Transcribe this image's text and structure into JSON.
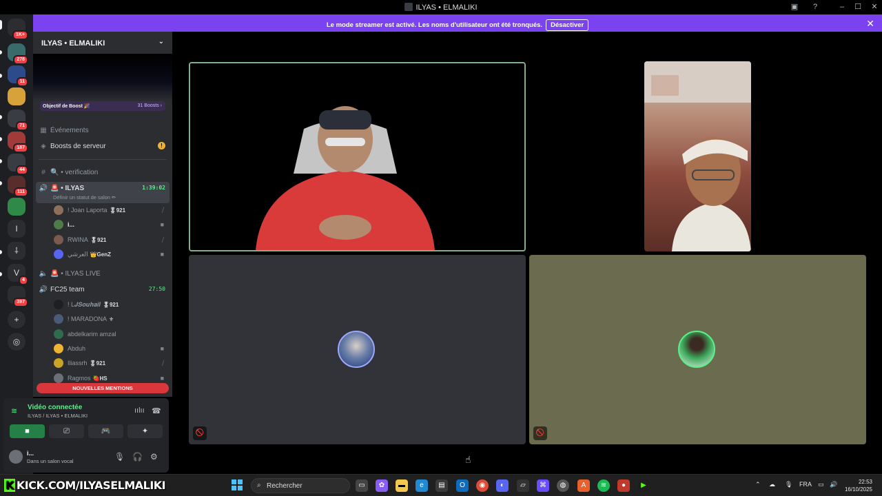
{
  "window": {
    "title": "ILYAS • ELMALIKI"
  },
  "banner": {
    "message": "Le mode streamer est activé. Les noms d'utilisateur ont été tronqués.",
    "button": "Désactiver"
  },
  "rail": {
    "items": [
      {
        "icon": "discord-home-icon",
        "badge": "1K+"
      },
      {
        "icon": "server-icon",
        "badge": "278"
      },
      {
        "icon": "server-icon",
        "badge": "11"
      },
      {
        "icon": "server-icon",
        "badge": ""
      },
      {
        "icon": "server-icon",
        "badge": "71"
      },
      {
        "icon": "server-icon",
        "badge": "187"
      },
      {
        "icon": "server-icon",
        "badge": "44"
      },
      {
        "icon": "server-icon",
        "badge": "111"
      },
      {
        "icon": "server-icon",
        "badge": ""
      },
      {
        "icon": "server-letter",
        "label": "I",
        "badge": ""
      },
      {
        "icon": "server-icon",
        "label": "⸸",
        "badge": ""
      },
      {
        "icon": "server-letter",
        "label": "V",
        "badge": "4"
      },
      {
        "icon": "server-icon",
        "badge": "397"
      }
    ]
  },
  "sidebar": {
    "server_name": "ILYAS • ELMALIKI",
    "boost_goal": "Objectif de Boost 🎉",
    "boost_count": "31 Boosts",
    "events": "Événements",
    "server_boosts": "Boosts de serveur",
    "channels": {
      "verification": "🔍 • verification",
      "ilyas": "🚨 • ILYAS",
      "ilyas_time": "1:39:02",
      "ilyas_status": "Définir un statut de salon ✏",
      "ilyas_live": "🚨 • ILYAS LIVE",
      "fc25": "FC25 team",
      "fc25_time": "27:50"
    },
    "ilyas_users": [
      {
        "name": "! Joan Laporta",
        "tag": "🎖921",
        "state": "mute",
        "color": "#8e6f5c"
      },
      {
        "name": "i...",
        "tag": "",
        "state": "video",
        "color": "#4f7a4a",
        "bold": true
      },
      {
        "name": "RWINA",
        "tag": "🎖921",
        "state": "mute",
        "color": "#7a5b4d"
      },
      {
        "name": "العرشي",
        "tag": "👑GenZ",
        "state": "video",
        "color": "#5865f2"
      }
    ],
    "fc25_users": [
      {
        "name": "! L𝑱𝑺𝒐𝒖𝒉𝒂𝒊𝒍",
        "tag": "🎖921",
        "state": "",
        "color": "#1e1f22"
      },
      {
        "name": "! MARADONA",
        "tag": "⚜",
        "state": "",
        "color": "#4a5a7a"
      },
      {
        "name": "abdelkarim amzal",
        "tag": "",
        "state": "",
        "color": "#2f6b4f"
      },
      {
        "name": "Abduh",
        "tag": "",
        "state": "video",
        "color": "#f0b232"
      },
      {
        "name": "Iliassrh",
        "tag": "🎖921",
        "state": "mute",
        "color": "#c9a227"
      },
      {
        "name": "Ragmos",
        "tag": "🍓HS",
        "state": "video",
        "color": "#6d6f78"
      }
    ],
    "new_mentions": "NOUVELLES MENTIONS"
  },
  "voice_panel": {
    "status": "Vidéo connectée",
    "location": "ILYAS / ILYAS • ELMALIKI",
    "buttons": [
      "camera-icon",
      "screen-share-icon",
      "activity-icon",
      "soundboard-icon"
    ]
  },
  "user_panel": {
    "name": "i...",
    "status": "Dans un salon vocal"
  },
  "taskbar": {
    "overlay_text": "KICK.COM/ILYASELMALIKI",
    "search_placeholder": "Rechercher",
    "lang": "FRA",
    "time": "22:53",
    "date": "16/10/2025"
  },
  "colors": {
    "accent": "#7b43f0",
    "speaking_border": "#7fb28a",
    "online": "#57f287",
    "mention": "#da373c"
  }
}
